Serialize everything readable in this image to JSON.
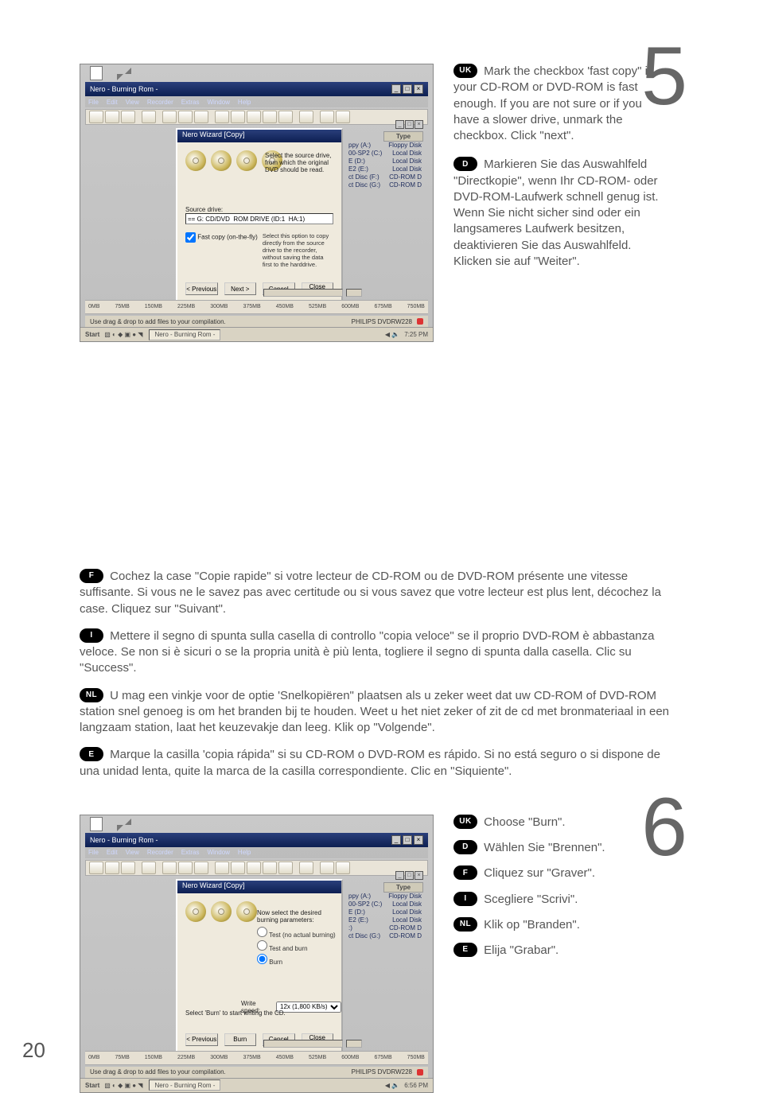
{
  "page_number": "20",
  "steps": {
    "s5": {
      "number": "5"
    },
    "s6": {
      "number": "6"
    }
  },
  "screenshot5": {
    "window_title": "Nero - Burning Rom -",
    "menu": {
      "file": "File",
      "edit": "Edit",
      "view": "View",
      "recorder": "Recorder",
      "extras": "Extras",
      "window": "Window",
      "help": "Help"
    },
    "wizard_title": "Nero Wizard [Copy]",
    "select_source_text": "Select the source drive, from which the original DVD should be read.",
    "source_drive_label": "Source drive:",
    "source_drive_value": "== G: CD/DVD  ROM DRIVE (ID:1  HA:1)",
    "fast_copy_label": "Fast copy (on-the-fly)",
    "fast_copy_hint": "Select this option to copy directly from the source drive to the recorder, without saving the data first to the harddrive.",
    "buttons": {
      "prev": "< Previous",
      "next": "Next >",
      "cancel": "Cancel",
      "close": "Close Wizard"
    },
    "drive_panel": {
      "type_header": "Type",
      "rows": {
        "0": {
          "name": "ppy (A:)",
          "type": "Floppy Disk"
        },
        "1": {
          "name": "00-SP2 (C:)",
          "type": "Local Disk"
        },
        "2": {
          "name": "E (D:)",
          "type": "Local Disk"
        },
        "3": {
          "name": "E2 (E:)",
          "type": "Local Disk"
        },
        "4": {
          "name": "ct Disc (F:)",
          "type": "CD-ROM D"
        },
        "5": {
          "name": "ct Disc (G:)",
          "type": "CD-ROM D"
        }
      }
    },
    "ruler": {
      "t0": "0MB",
      "t1": "75MB",
      "t2": "150MB",
      "t3": "225MB",
      "t4": "300MB",
      "t5": "375MB",
      "t6": "450MB",
      "t7": "525MB",
      "t8": "600MB",
      "t9": "675MB",
      "t10": "750MB"
    },
    "status_text": "Use drag & drop to add files to your compilation.",
    "status_device": "PHILIPS DVDRW228",
    "taskbar": {
      "start": "Start",
      "app": "Nero - Burning Rom -",
      "clock": "7:25 PM"
    }
  },
  "screenshot6": {
    "window_title": "Nero - Burning Rom -",
    "menu": {
      "file": "File",
      "edit": "Edit",
      "view": "View",
      "recorder": "Recorder",
      "extras": "Extras",
      "window": "Window",
      "help": "Help"
    },
    "wizard_title": "Nero Wizard [Copy]",
    "param_text": "Now select the desired burning parameters:",
    "radios": {
      "test": "Test (no actual burning)",
      "testburn": "Test and burn",
      "burn": "Burn"
    },
    "write_speed_label": "Write speed:",
    "write_speed_value": "12x (1,800 KB/s)",
    "select_burn_text": "Select 'Burn' to start writing the CD.",
    "buttons": {
      "prev": "< Previous",
      "burn": "Burn",
      "cancel": "Cancel",
      "close": "Close Wizard"
    },
    "drive_panel": {
      "type_header": "Type",
      "rows": {
        "0": {
          "name": "ppy (A:)",
          "type": "Floppy Disk"
        },
        "1": {
          "name": "00-SP2 (C:)",
          "type": "Local Disk"
        },
        "2": {
          "name": "E (D:)",
          "type": "Local Disk"
        },
        "3": {
          "name": "E2 (E:)",
          "type": "Local Disk"
        },
        "4": {
          "name": ":)",
          "type": "CD-ROM D"
        },
        "5": {
          "name": "ct Disc (G:)",
          "type": "CD-ROM D"
        }
      }
    },
    "ruler": {
      "t0": "0MB",
      "t1": "75MB",
      "t2": "150MB",
      "t3": "225MB",
      "t4": "300MB",
      "t5": "375MB",
      "t6": "450MB",
      "t7": "525MB",
      "t8": "600MB",
      "t9": "675MB",
      "t10": "750MB"
    },
    "status_text": "Use drag & drop to add files to your compilation.",
    "status_device": "PHILIPS DVDRW228",
    "taskbar": {
      "start": "Start",
      "app": "Nero - Burning Rom -",
      "clock": "6:56 PM"
    }
  },
  "instructions": {
    "s5": {
      "uk": {
        "chip": "UK",
        "text": "Mark the checkbox 'fast copy\" if your CD-ROM or DVD-ROM is fast enough. If you are not sure or if you have a slower drive, unmark the checkbox. Click \"next\"."
      },
      "d": {
        "chip": "D",
        "text": "Markieren Sie das Auswahlfeld \"Directkopie\", wenn Ihr CD-ROM- oder DVD-ROM-Laufwerk schnell genug ist. Wenn Sie nicht sicher sind oder ein langsameres Laufwerk besitzen, deaktivieren Sie das Auswahlfeld. Klicken sie auf \"Weiter\"."
      },
      "f": {
        "chip": "F",
        "text": "Cochez la case \"Copie rapide\" si votre lecteur de CD-ROM ou de DVD-ROM présente une vitesse suffisante. Si vous ne le savez pas avec certitude ou si vous savez que votre lecteur est plus lent, décochez la case. Cliquez sur \"Suivant\"."
      },
      "i": {
        "chip": "I",
        "text": "Mettere il segno di spunta sulla casella di controllo \"copia veloce\" se il proprio DVD-ROM è abbastanza veloce. Se non si è sicuri o se la propria unità è più lenta, togliere il segno di spunta dalla casella. Clic su \"Success\"."
      },
      "nl": {
        "chip": "NL",
        "text": "U mag een vinkje voor de optie 'Snelkopiëren\" plaatsen als u zeker weet dat uw CD-ROM of DVD-ROM station snel genoeg is om het branden bij te houden. Weet u het niet zeker of zit de cd met bronmateriaal in een langzaam station, laat het keuzevakje dan leeg. Klik op \"Volgende\"."
      },
      "e": {
        "chip": "E",
        "text": "Marque la casilla 'copia rápida\" si su CD-ROM o DVD-ROM es rápido. Si no está seguro o si dispone de una unidad lenta, quite la marca de la casilla correspondiente. Clic en \"Siquiente\"."
      }
    },
    "s6": {
      "uk": {
        "chip": "UK",
        "text": "Choose \"Burn\"."
      },
      "d": {
        "chip": "D",
        "text": "Wählen Sie \"Brennen\"."
      },
      "f": {
        "chip": "F",
        "text": "Cliquez sur \"Graver\"."
      },
      "i": {
        "chip": "I",
        "text": "Scegliere \"Scrivi\"."
      },
      "nl": {
        "chip": "NL",
        "text": "Klik op \"Branden\"."
      },
      "e": {
        "chip": "E",
        "text": "Elija \"Grabar\"."
      }
    }
  }
}
